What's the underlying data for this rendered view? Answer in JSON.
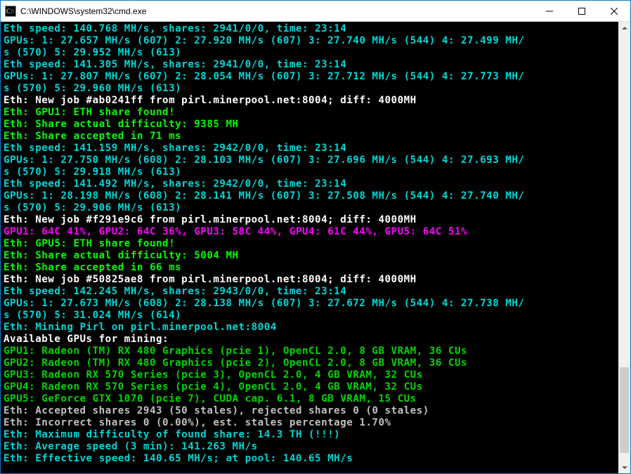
{
  "window": {
    "title": "C:\\WINDOWS\\system32\\cmd.exe"
  },
  "colors": {
    "teal": "#00d7d7",
    "white": "#ffffff",
    "gray": "#c0c0c0",
    "green": "#00ff00",
    "lime": "#00d700",
    "magenta": "#ff00ff"
  },
  "scrollbar": {
    "thumb_top_pct": 78,
    "thumb_height_pct": 20
  },
  "lines": [
    {
      "runs": [
        {
          "c": "teal",
          "t": "Eth speed: 140.768 MH/s, shares: 2941/0/0, time: 23:14"
        }
      ]
    },
    {
      "runs": [
        {
          "c": "teal",
          "t": "GPUs: 1: 27.657 MH/s (607) 2: 27.920 MH/s (607) 3: 27.740 MH/s (544) 4: 27.499 MH/s (570) 5: 29.952 MH/s (613)"
        }
      ]
    },
    {
      "runs": [
        {
          "c": "teal",
          "t": "Eth speed: 141.305 MH/s, shares: 2941/0/0, time: 23:14"
        }
      ]
    },
    {
      "runs": [
        {
          "c": "teal",
          "t": "GPUs: 1: 27.807 MH/s (607) 2: 28.054 MH/s (607) 3: 27.712 MH/s (544) 4: 27.773 MH/s (570) 5: 29.960 MH/s (613)"
        }
      ]
    },
    {
      "runs": [
        {
          "c": "white",
          "t": "Eth: New job #ab0241ff from pirl.minerpool.net:8004; diff: 4000MH"
        }
      ]
    },
    {
      "runs": [
        {
          "c": "green",
          "t": "Eth: GPU1: ETH share found!"
        }
      ]
    },
    {
      "runs": [
        {
          "c": "green",
          "t": "Eth: Share actual difficulty: 9385 MH"
        }
      ]
    },
    {
      "runs": [
        {
          "c": "green",
          "t": "Eth: Share accepted in 71 ms"
        }
      ]
    },
    {
      "runs": [
        {
          "c": "teal",
          "t": "Eth speed: 141.159 MH/s, shares: 2942/0/0, time: 23:14"
        }
      ]
    },
    {
      "runs": [
        {
          "c": "teal",
          "t": "GPUs: 1: 27.750 MH/s (608) 2: 28.103 MH/s (607) 3: 27.696 MH/s (544) 4: 27.693 MH/s (570) 5: 29.918 MH/s (613)"
        }
      ]
    },
    {
      "runs": [
        {
          "c": "teal",
          "t": "Eth speed: 141.492 MH/s, shares: 2942/0/0, time: 23:14"
        }
      ]
    },
    {
      "runs": [
        {
          "c": "teal",
          "t": "GPUs: 1: 28.198 MH/s (608) 2: 28.141 MH/s (607) 3: 27.508 MH/s (544) 4: 27.740 MH/s (570) 5: 29.906 MH/s (613)"
        }
      ]
    },
    {
      "runs": [
        {
          "c": "white",
          "t": "Eth: New job #f291e9c6 from pirl.minerpool.net:8004; diff: 4000MH"
        }
      ]
    },
    {
      "runs": [
        {
          "c": "magenta",
          "t": "GPU1: 64C 41%, GPU2: 64C 36%, GPU3: 58C 44%, GPU4: 61C 44%, GPU5: 64C 51%"
        }
      ]
    },
    {
      "runs": [
        {
          "c": "green",
          "t": "Eth: GPU5: ETH share found!"
        }
      ]
    },
    {
      "runs": [
        {
          "c": "green",
          "t": "Eth: Share actual difficulty: 5004 MH"
        }
      ]
    },
    {
      "runs": [
        {
          "c": "green",
          "t": "Eth: Share accepted in 66 ms"
        }
      ]
    },
    {
      "runs": [
        {
          "c": "white",
          "t": "Eth: New job #50825ae8 from pirl.minerpool.net:8004; diff: 4000MH"
        }
      ]
    },
    {
      "runs": [
        {
          "c": "teal",
          "t": "Eth speed: 142.245 MH/s, shares: 2943/0/0, time: 23:14"
        }
      ]
    },
    {
      "runs": [
        {
          "c": "teal",
          "t": "GPUs: 1: 27.673 MH/s (608) 2: 28.138 MH/s (607) 3: 27.672 MH/s (544) 4: 27.738 MH/s (570) 5: 31.024 MH/s (614)"
        }
      ]
    },
    {
      "runs": [
        {
          "c": "teal",
          "t": ""
        }
      ]
    },
    {
      "runs": [
        {
          "c": "teal",
          "t": "Eth: Mining Pirl on pirl.minerpool.net:8004"
        }
      ]
    },
    {
      "runs": [
        {
          "c": "white",
          "t": "Available GPUs for mining:"
        }
      ]
    },
    {
      "runs": [
        {
          "c": "lime",
          "t": "GPU1: Radeon (TM) RX 480 Graphics (pcie 1), OpenCL 2.0, 8 GB VRAM, 36 CUs"
        }
      ]
    },
    {
      "runs": [
        {
          "c": "lime",
          "t": "GPU2: Radeon (TM) RX 480 Graphics (pcie 2), OpenCL 2.0, 8 GB VRAM, 36 CUs"
        }
      ]
    },
    {
      "runs": [
        {
          "c": "lime",
          "t": "GPU3: Radeon RX 570 Series (pcie 3), OpenCL 2.0, 4 GB VRAM, 32 CUs"
        }
      ]
    },
    {
      "runs": [
        {
          "c": "lime",
          "t": "GPU4: Radeon RX 570 Series (pcie 4), OpenCL 2.0, 4 GB VRAM, 32 CUs"
        }
      ]
    },
    {
      "runs": [
        {
          "c": "lime",
          "t": "GPU5: GeForce GTX 1070 (pcie 7), CUDA cap. 6.1, 8 GB VRAM, 15 CUs"
        }
      ]
    },
    {
      "runs": [
        {
          "c": "gray",
          "t": "Eth: Accepted shares 2943 (50 stales), rejected shares 0 (0 stales)"
        }
      ]
    },
    {
      "runs": [
        {
          "c": "gray",
          "t": "Eth: Incorrect shares 0 (0.00%), est. stales percentage 1.70%"
        }
      ]
    },
    {
      "runs": [
        {
          "c": "teal",
          "t": "Eth: Maximum difficulty of found share: 14.3 TH (!!!)"
        }
      ]
    },
    {
      "runs": [
        {
          "c": "teal",
          "t": "Eth: Average speed (3 min): 141.263 MH/s"
        }
      ]
    },
    {
      "runs": [
        {
          "c": "teal",
          "t": "Eth: Effective speed: 140.65 MH/s; at pool: 140.65 MH/s"
        }
      ]
    }
  ]
}
